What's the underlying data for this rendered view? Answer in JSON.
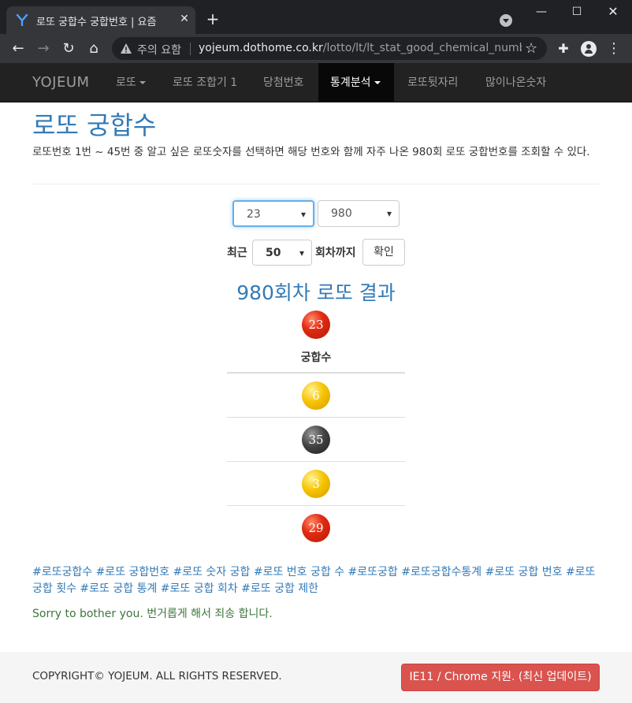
{
  "browser": {
    "tab_title": "로또 궁합수 궁합번호 | 요즘",
    "tab_close": "✕",
    "new_tab": "+",
    "security_label": "주의 요함",
    "url_host": "yojeum.dothome.co.kr",
    "url_path": "/lotto/lt/lt_stat_good_chemical_number....",
    "window_controls": {
      "minimize": "—",
      "maximize": "☐",
      "close": "✕"
    }
  },
  "navbar": {
    "brand": "YOJEUM",
    "items": [
      {
        "label": "로또",
        "has_caret": true
      },
      {
        "label": "로또 조합기 1"
      },
      {
        "label": "당첨번호"
      },
      {
        "label": "통계분석",
        "has_caret": true,
        "active": true
      },
      {
        "label": "로또뒷자리"
      },
      {
        "label": "많이나온숫자"
      }
    ]
  },
  "page": {
    "title": "로또 궁합수",
    "description": "로또번호 1번 ~ 45번 중 알고 싶은 로또숫자를 선택하면 해당 번호와 함께 자주 나온 980회 로또 궁합번호를 조회할 수 있다."
  },
  "form": {
    "number_select_value": "23",
    "round_select_value": "980",
    "recent_label": "최근",
    "recent_select_value": "50",
    "until_label": "회차까지",
    "confirm_button": "확인"
  },
  "result": {
    "title": "980회차 로또 결과",
    "selected_ball": {
      "number": "23",
      "color": "red"
    },
    "table_header": "궁합수",
    "chemistry_balls": [
      {
        "number": "6",
        "color": "yellow"
      },
      {
        "number": "35",
        "color": "dark"
      },
      {
        "number": "3",
        "color": "yellow"
      },
      {
        "number": "29",
        "color": "red"
      }
    ]
  },
  "tags_text": "#로또궁합수 #로또 궁합번호 #로또 숫자 궁합 #로또 번호 궁합 수 #로또궁합 #로또궁합수통계 #로또 궁합 번호 #로또 궁합 횟수 #로또 궁합 통계 #로또 궁합 회차 #로또 궁합 제한",
  "sorry_text": "Sorry to bother you. 번거롭게 해서 죄송 합니다.",
  "footer": {
    "copyright": "COPYRIGHT© YOJEUM. ALL RIGHTS RESERVED.",
    "ie_button": "IE11 / Chrome 지원. (최신 업데이트)"
  },
  "colors": {
    "link_blue": "#337ab7",
    "navbar_bg": "#222222",
    "danger_red": "#d9534f",
    "success_green": "#3c763d"
  }
}
